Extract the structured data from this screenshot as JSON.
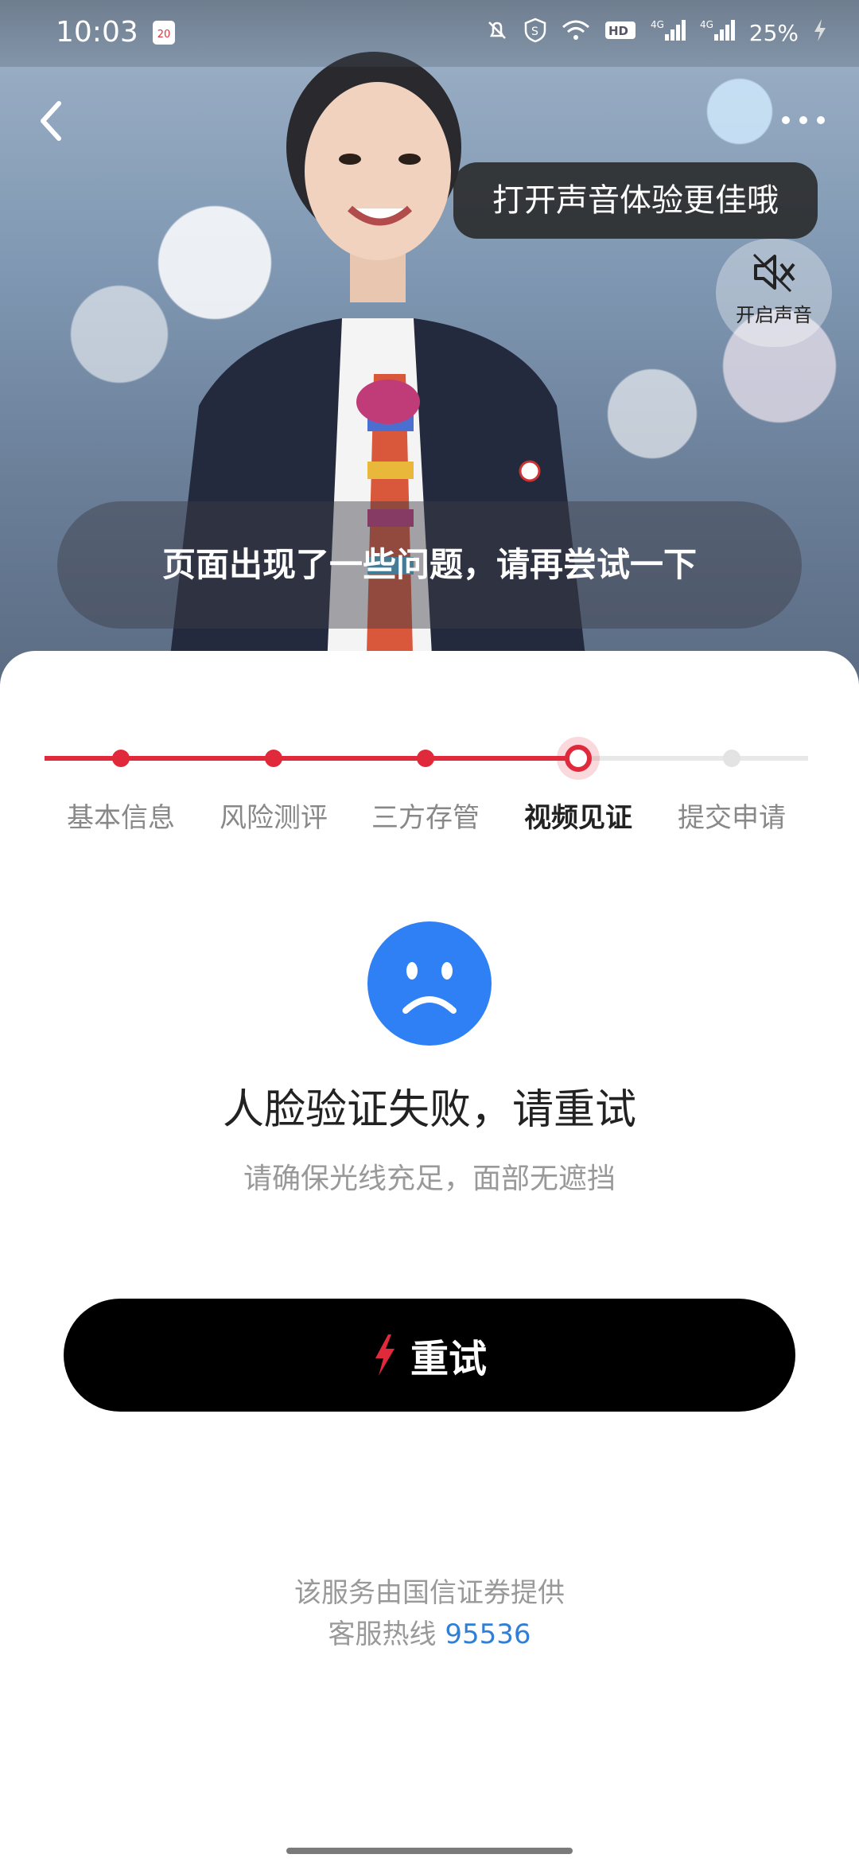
{
  "status_bar": {
    "time": "10:03",
    "calendar_day": "20",
    "network_1": "4G",
    "network_2": "4G",
    "battery": "25%"
  },
  "video": {
    "sound_tip": "打开声音体验更佳哦",
    "sound_button_label": "开启声音",
    "notice": "页面出现了一些问题，请再尝试一下"
  },
  "steps": [
    {
      "label": "基本信息",
      "state": "done"
    },
    {
      "label": "风险测评",
      "state": "done"
    },
    {
      "label": "三方存管",
      "state": "done"
    },
    {
      "label": "视频见证",
      "state": "current"
    },
    {
      "label": "提交申请",
      "state": "todo"
    }
  ],
  "result": {
    "title": "人脸验证失败，请重试",
    "subtitle": "请确保光线充足，面部无遮挡"
  },
  "retry_button": {
    "label": "重试"
  },
  "footer": {
    "provider": "该服务由国信证券提供",
    "hotline_label": "客服热线",
    "hotline_number": "95536"
  },
  "colors": {
    "accent": "#e02a3c",
    "link": "#2f7fd6",
    "sad_face": "#2f80f5"
  }
}
